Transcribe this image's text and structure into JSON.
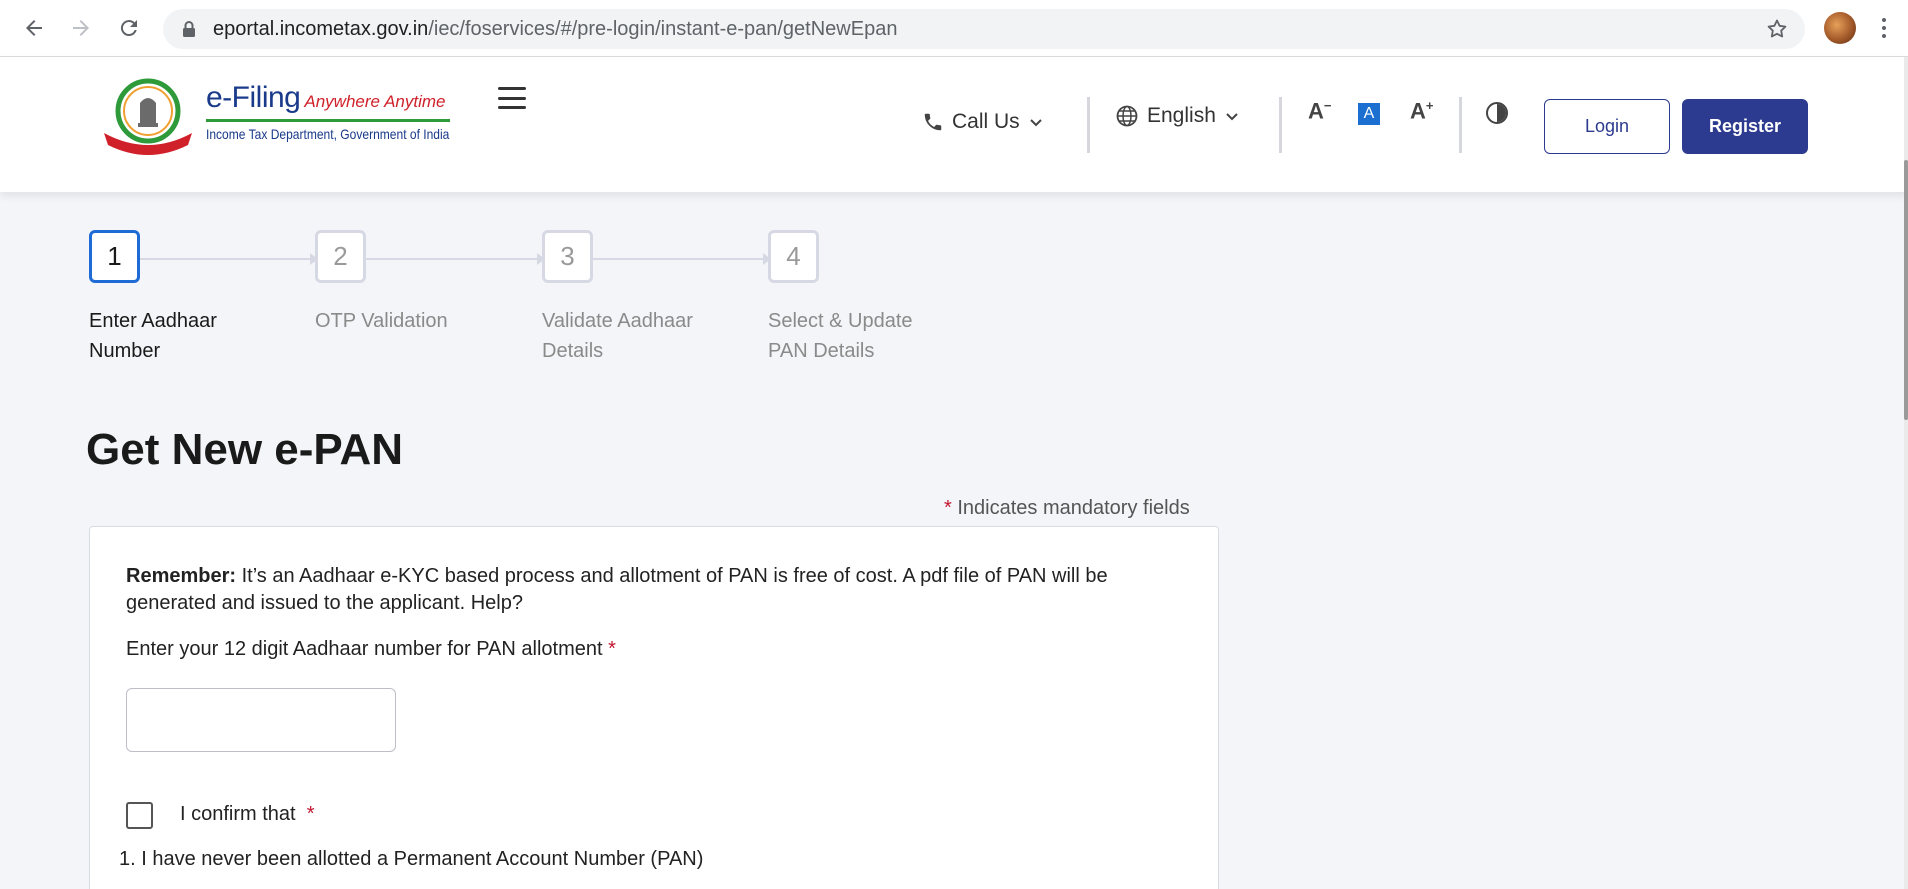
{
  "browser": {
    "url_host": "eportal.incometax.gov.in",
    "url_path": "/iec/foservices/#/pre-login/instant-e-pan/getNewEpan"
  },
  "header": {
    "brand_main": "e-Filing",
    "brand_tag": "Anywhere Anytime",
    "brand_sub": "Income Tax Department, Government of India",
    "call_us": "Call Us",
    "language": "English",
    "font_decrease": "A",
    "font_default": "A",
    "font_increase": "A",
    "login_label": "Login",
    "register_label": "Register"
  },
  "steps": [
    {
      "number": "1",
      "label_line1": "Enter Aadhaar",
      "label_line2": "Number"
    },
    {
      "number": "2",
      "label_line1": "OTP Validation",
      "label_line2": ""
    },
    {
      "number": "3",
      "label_line1": "Validate Aadhaar",
      "label_line2": "Details"
    },
    {
      "number": "4",
      "label_line1": "Select & Update",
      "label_line2": "PAN Details"
    }
  ],
  "form": {
    "title": "Get New e-PAN",
    "mandatory_star": "*",
    "mandatory_note": "Indicates mandatory fields",
    "remember_label": "Remember:",
    "remember_text": "It’s an Aadhaar e-KYC based process and allotment of PAN is free of cost. A pdf file of PAN will be generated and issued to the applicant. Help?",
    "aadhaar_label": "Enter your 12 digit Aadhaar number for PAN allotment",
    "aadhaar_value": "",
    "confirm_label": "I confirm that",
    "confirm_item_1": "1. I have never been allotted a Permanent Account Number (PAN)"
  },
  "colors": {
    "primary": "#2c3b8f",
    "active_step": "#1f6bd6",
    "required": "#c0152f",
    "page_bg": "#f4f5f9"
  }
}
